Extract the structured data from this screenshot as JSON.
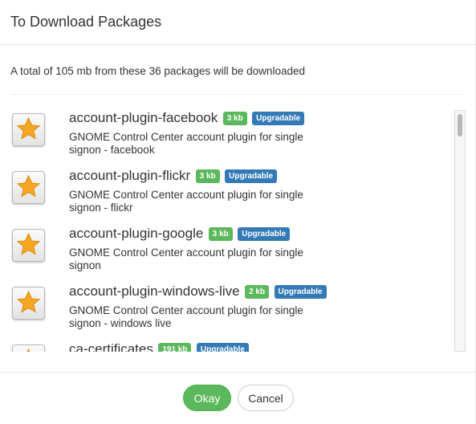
{
  "dialog": {
    "title": "To Download Packages",
    "summary": "A total of 105 mb from these 36 packages will be downloaded"
  },
  "packages": [
    {
      "name": "account-plugin-facebook",
      "size": "3 kb",
      "status": "Upgradable",
      "description": "GNOME Control Center account plugin for single signon - facebook",
      "icon": "star-icon"
    },
    {
      "name": "account-plugin-flickr",
      "size": "3 kb",
      "status": "Upgradable",
      "description": "GNOME Control Center account plugin for single signon - flickr",
      "icon": "star-icon"
    },
    {
      "name": "account-plugin-google",
      "size": "3 kb",
      "status": "Upgradable",
      "description": "GNOME Control Center account plugin for single signon",
      "icon": "star-icon"
    },
    {
      "name": "account-plugin-windows-live",
      "size": "2 kb",
      "status": "Upgradable",
      "description": "GNOME Control Center account plugin for single signon - windows live",
      "icon": "star-icon"
    },
    {
      "name": "ca-certificates",
      "size": "191 kb",
      "status": "Upgradable",
      "description": "",
      "icon": "star-icon"
    }
  ],
  "buttons": {
    "ok_label": "Okay",
    "cancel_label": "Cancel"
  },
  "colors": {
    "size_badge": "#5cb85c",
    "status_badge": "#337ab7",
    "ok_button": "#5cb85c",
    "star": "#f5a623"
  }
}
